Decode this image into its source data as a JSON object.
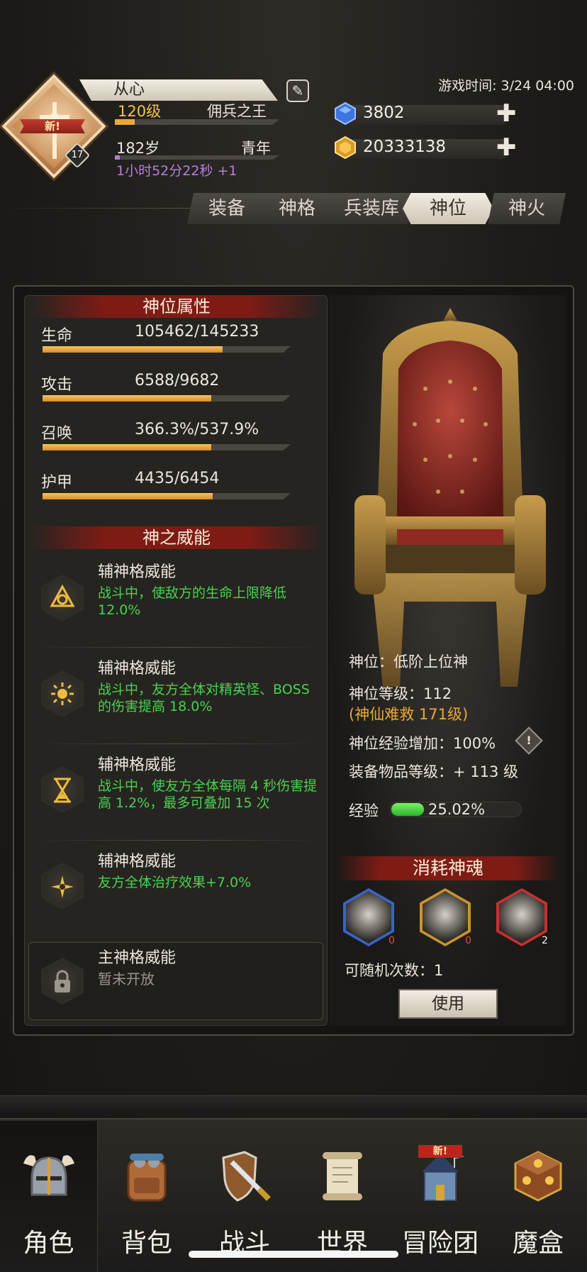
{
  "player": {
    "name": "从心",
    "level_label": "120级",
    "title": "佣兵之王",
    "level_progress": 0.12,
    "age_label": "182岁",
    "age_stage": "青年",
    "age_progress": 0.03,
    "timer": "1小时52分22秒 +1",
    "avatar_badge": "新!",
    "avatar_level": "17"
  },
  "game_time": "游戏时间: 3/24 04:00",
  "currencies": [
    {
      "icon": "blue-gem-icon",
      "value": "3802"
    },
    {
      "icon": "gold-gem-icon",
      "value": "20333138"
    }
  ],
  "tabs": [
    {
      "label": "装备",
      "active": false
    },
    {
      "label": "神格",
      "active": false
    },
    {
      "label": "兵装库",
      "active": false
    },
    {
      "label": "神位",
      "active": true
    },
    {
      "label": "神火",
      "active": false
    }
  ],
  "attributes": {
    "header": "神位属性",
    "items": [
      {
        "label": "生命",
        "value": "105462/145233",
        "progress": 0.726
      },
      {
        "label": "攻击",
        "value": "6588/9682",
        "progress": 0.68
      },
      {
        "label": "召唤",
        "value": "366.3%/537.9%",
        "progress": 0.68
      },
      {
        "label": "护甲",
        "value": "4435/6454",
        "progress": 0.687
      }
    ]
  },
  "powers": {
    "header": "神之威能",
    "items": [
      {
        "title": "辅神格威能",
        "desc": "战斗中，使敌方的生命上限降低 12.0%",
        "icon": "triangle-emblem-icon"
      },
      {
        "title": "辅神格威能",
        "desc": "战斗中，友方全体对精英怪、BOSS的伤害提高 18.0%",
        "icon": "sun-icon"
      },
      {
        "title": "辅神格威能",
        "desc": "战斗中，使友方全体每隔 4 秒伤害提高 1.2%，最多可叠加 15 次",
        "icon": "hourglass-icon"
      },
      {
        "title": "辅神格威能",
        "desc": "友方全体治疗效果+7.0%",
        "icon": "star-compass-icon"
      }
    ],
    "locked": {
      "title": "主神格威能",
      "desc": "暂未开放"
    }
  },
  "godhood": {
    "rank": "神位：低阶上位神",
    "level": "神位等级：112",
    "level_note": "(神仙难救 171级)",
    "exp_bonus": "神位经验增加：100%",
    "equip_level": "装备物品等级：+ 113 级",
    "exp_label": "经验",
    "exp_value": "25.02%",
    "exp_progress": 0.2502
  },
  "consume": {
    "header": "消耗神魂",
    "souls": [
      {
        "count": "0",
        "color": "#3a63c9"
      },
      {
        "count": "0",
        "color": "#c9932e"
      },
      {
        "count": "2",
        "color": "#c92f2f"
      }
    ],
    "random_count": "可随机次数：1",
    "use_button": "使用"
  },
  "nav": [
    {
      "label": "角色",
      "icon": "helmet-icon",
      "active": true
    },
    {
      "label": "背包",
      "icon": "backpack-icon",
      "active": false
    },
    {
      "label": "战斗",
      "icon": "sword-shield-icon",
      "active": false
    },
    {
      "label": "世界",
      "icon": "scroll-icon",
      "active": false
    },
    {
      "label": "冒险团",
      "icon": "castle-icon",
      "active": false,
      "badge": "新!"
    },
    {
      "label": "魔盒",
      "icon": "magic-box-icon",
      "active": false
    }
  ]
}
